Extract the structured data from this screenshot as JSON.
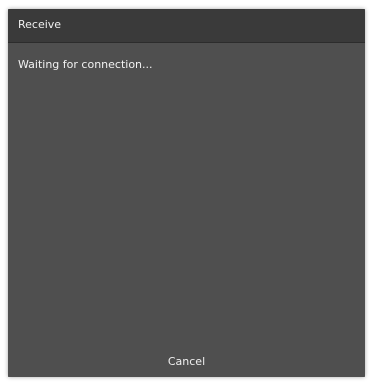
{
  "dialog": {
    "title": "Receive",
    "message": "Waiting for connection...",
    "cancel_label": "Cancel"
  },
  "colors": {
    "titlebar": "#3a3a3a",
    "body": "#4f4f4f",
    "text": "#f0f0f0"
  }
}
